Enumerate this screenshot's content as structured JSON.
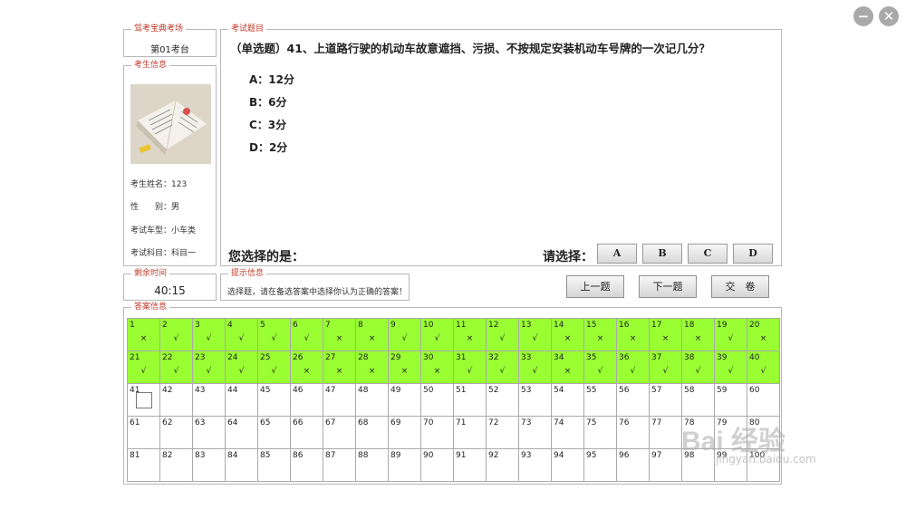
{
  "window": {
    "minimize": "−",
    "close": "✕"
  },
  "seat": {
    "legend": "驾考宝典考场",
    "value": "第01考台"
  },
  "candidate": {
    "legend": "考生信息",
    "name": "考生姓名：123",
    "gender": "性　　别：男",
    "vehicle": "考试车型：小车类",
    "subject": "考试科目：科目一"
  },
  "question": {
    "legend": "考试题目",
    "text": "（单选题）41、上道路行驶的机动车故意遮挡、污损、不按规定安装机动车号牌的一次记几分？",
    "options": [
      "A：12分",
      "B：6分",
      "C：3分",
      "D：2分"
    ],
    "your_choice_label": "您选择的是：",
    "select_label": "请选择：",
    "answer_buttons": [
      "A",
      "B",
      "C",
      "D"
    ]
  },
  "timer": {
    "legend": "剩余时间",
    "value": "40:15"
  },
  "hint": {
    "legend": "提示信息",
    "text": "选择题，请在备选答案中选择你认为正确的答案！"
  },
  "nav": {
    "prev": "上一题",
    "next": "下一题",
    "submit": "交　卷"
  },
  "answers": {
    "legend": "答案信息",
    "total": 100,
    "current": 41,
    "marks": [
      "×",
      "√",
      "√",
      "√",
      "√",
      "√",
      "×",
      "×",
      "√",
      "√",
      "×",
      "√",
      "√",
      "×",
      "×",
      "×",
      "×",
      "×",
      "√",
      "×",
      "√",
      "√",
      "√",
      "√",
      "√",
      "×",
      "×",
      "×",
      "×",
      "×",
      "√",
      "√",
      "√",
      "×",
      "√",
      "√",
      "√",
      "√",
      "√",
      "√"
    ]
  },
  "watermark": {
    "logo": "Bai 经验",
    "url": "jingyan.baidu.com"
  },
  "colors": {
    "answered": "#99ff33",
    "legend": "#c0392b"
  }
}
